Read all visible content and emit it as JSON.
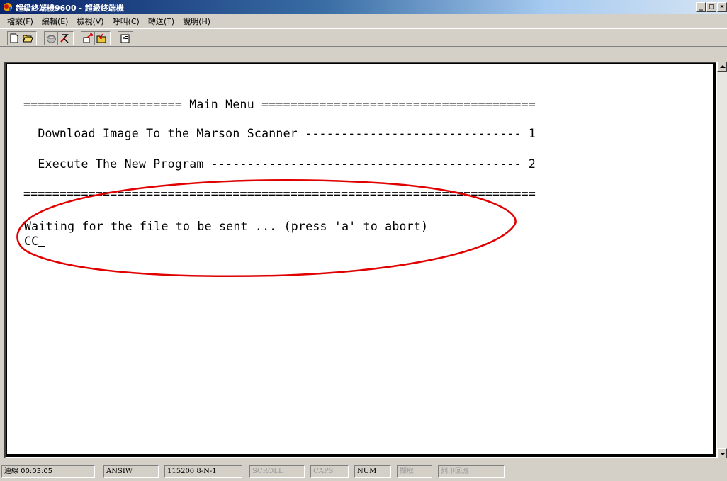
{
  "window": {
    "title": "超級終端機9600 - 超級終端機",
    "buttons": {
      "minimize": "_",
      "maximize": "□",
      "close": "×"
    }
  },
  "menubar": {
    "items": [
      "檔案(F)",
      "編輯(E)",
      "檢視(V)",
      "呼叫(C)",
      "轉送(T)",
      "說明(H)"
    ]
  },
  "toolbar": {
    "buttons": [
      "new-document-icon",
      "open-folder-icon",
      "phone-icon",
      "disconnect-icon",
      "send-icon",
      "receive-icon",
      "properties-icon"
    ]
  },
  "terminal": {
    "lines": [
      "====================== Main Menu ======================================",
      "  Download Image To the Marson Scanner ------------------------------ 1",
      "  Execute The New Program ------------------------------------------- 2",
      "=======================================================================",
      "Waiting for the file to be sent ... (press 'a' to abort)",
      "CC"
    ],
    "annotation_color": "#e00000"
  },
  "statusbar": {
    "connection_time": "連線 00:03:05",
    "emulation": "ANSIW",
    "port_settings": "115200 8-N-1",
    "scroll": "SCROLL",
    "caps": "CAPS",
    "num": "NUM",
    "capture": "擷取",
    "print_echo": "列印回應"
  }
}
